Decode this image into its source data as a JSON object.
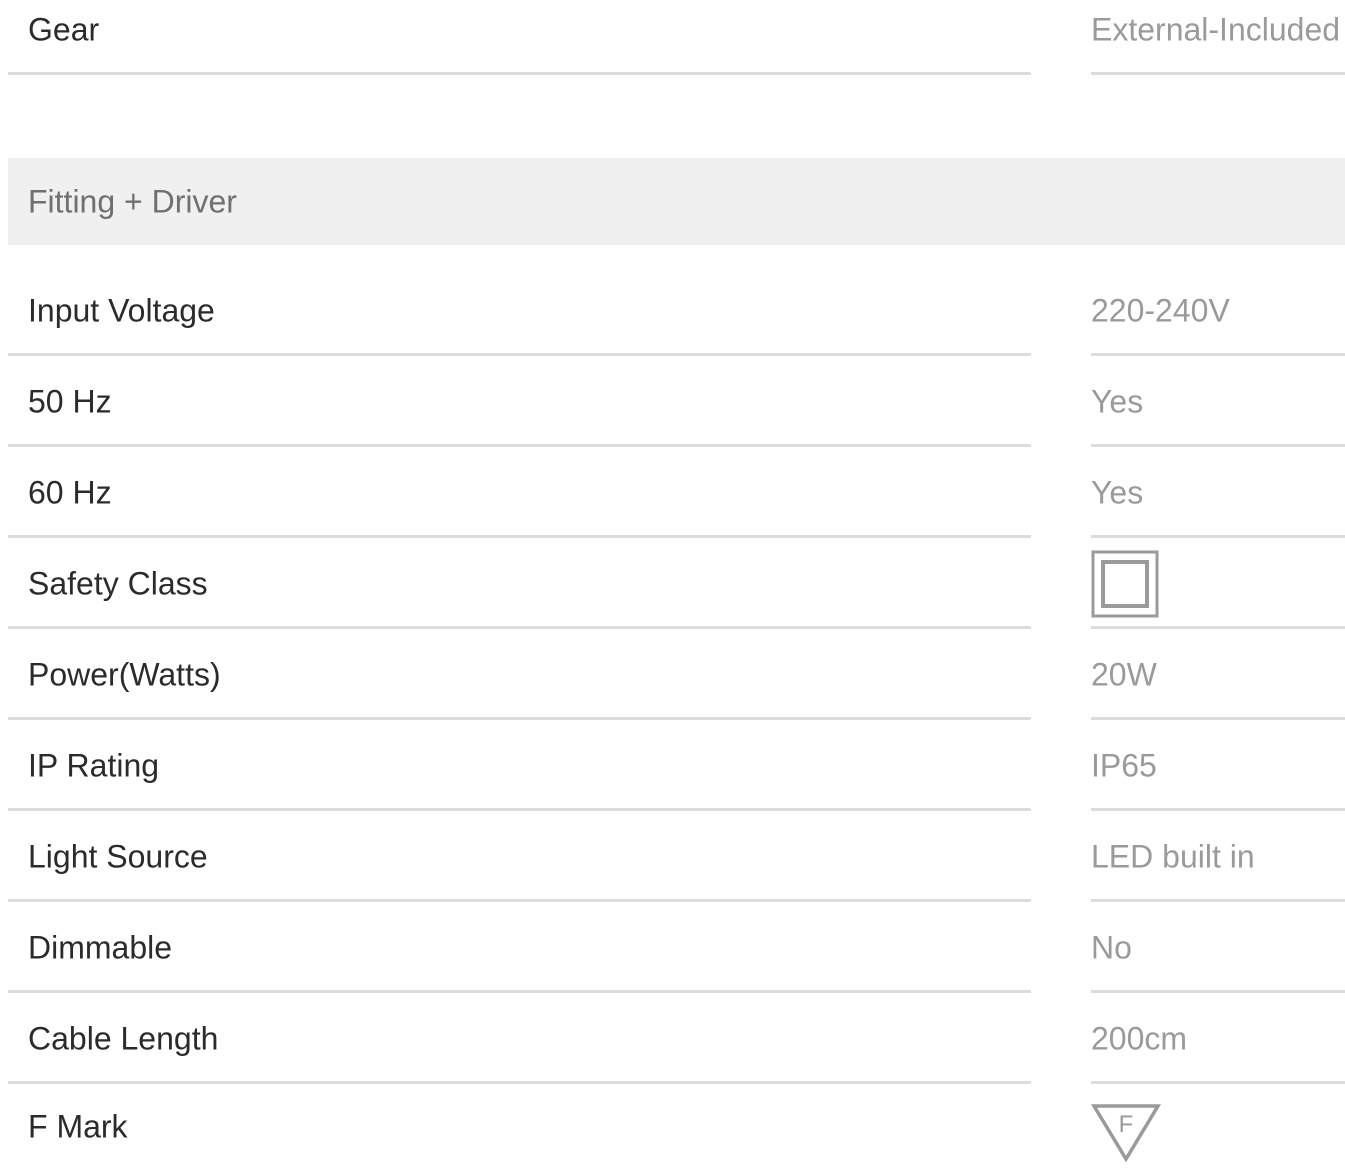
{
  "gear": {
    "label": "Gear",
    "value": "External-Included"
  },
  "section": {
    "title": "Fitting + Driver"
  },
  "specs": [
    {
      "label": "Input Voltage",
      "value": "220-240V"
    },
    {
      "label": "50 Hz",
      "value": "Yes"
    },
    {
      "label": "60 Hz",
      "value": "Yes"
    },
    {
      "label": "Safety Class",
      "icon": "class-ii-double-square-icon"
    },
    {
      "label": "Power(Watts)",
      "value": "20W"
    },
    {
      "label": "IP Rating",
      "value": "IP65"
    },
    {
      "label": "Light Source",
      "value": "LED built in"
    },
    {
      "label": "Dimmable",
      "value": "No"
    },
    {
      "label": "Cable Length",
      "value": "200cm"
    },
    {
      "label": "F Mark",
      "icon": "f-mark-triangle-icon",
      "icon_text": "F"
    }
  ],
  "colors": {
    "label": "#2b2b2b",
    "value": "#9a9a9a",
    "section_bg": "#f0f0f0",
    "section_text": "#707070",
    "divider": "#dcdcdc"
  }
}
